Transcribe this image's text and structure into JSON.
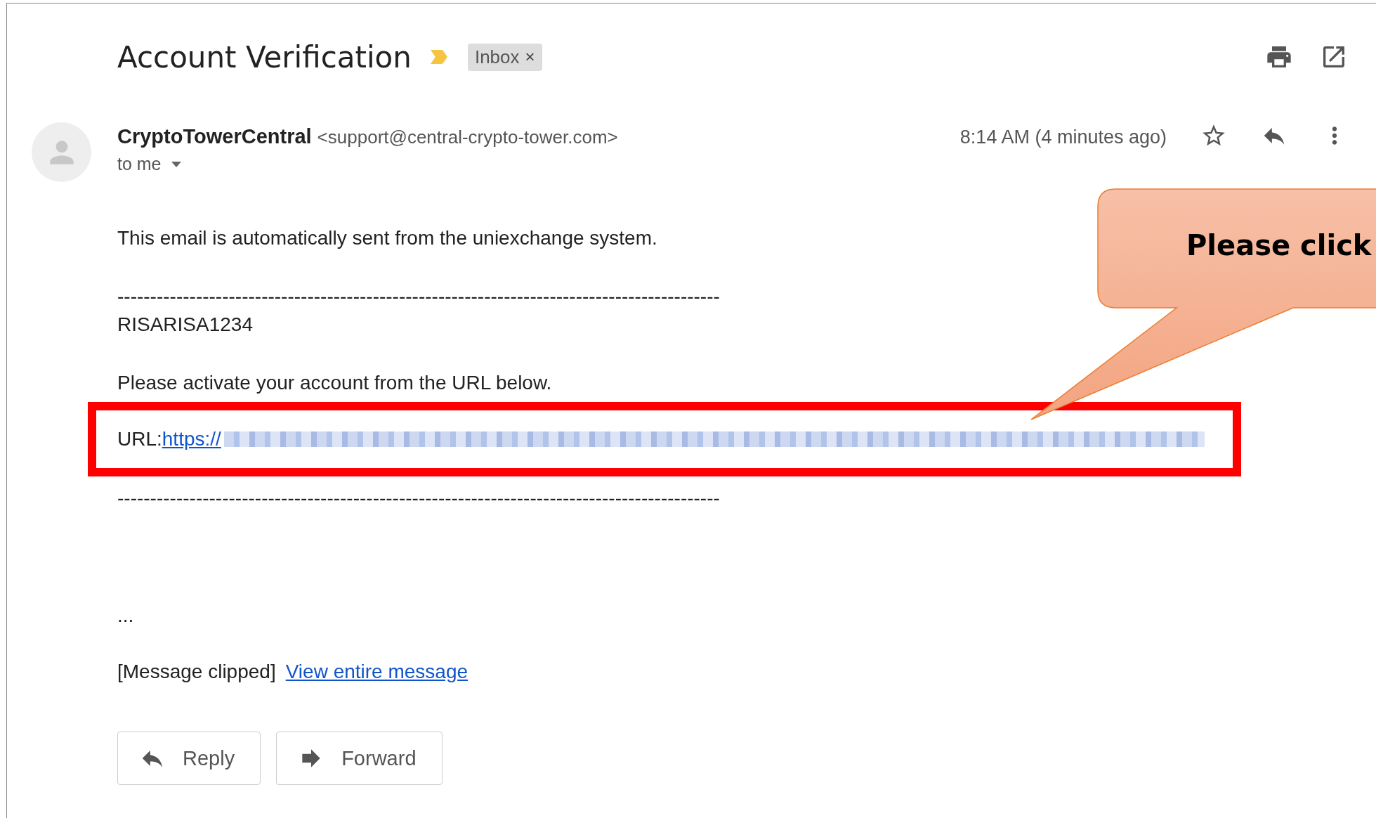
{
  "subject": "Account Verification",
  "important": true,
  "label": {
    "text": "Inbox",
    "remove": "×"
  },
  "sender": {
    "name": "CryptoTowerCentral",
    "email": "<support@central-crypto-tower.com>",
    "recipient": "to me",
    "time": "8:14 AM (4 minutes ago)",
    "starred": false
  },
  "paragraphs": [
    {
      "kind": "text",
      "lines": [
        "This email is automatically sent from the uniexchange system."
      ]
    },
    {
      "kind": "text",
      "lines": [
        "--------------------------------------------------------------------------------------------",
        "RISARISA1234"
      ]
    },
    {
      "kind": "text",
      "lines": [
        "Please activate your account from the URL below."
      ]
    },
    {
      "kind": "url",
      "label": "URL:",
      "link": "https://",
      "highlighted": true
    },
    {
      "kind": "text",
      "lines": [
        "--------------------------------------------------------------------------------------------"
      ]
    }
  ],
  "ellipsis": "...",
  "clipped": {
    "text": "[Message clipped]",
    "link": "View entire message"
  },
  "buttons": [
    {
      "kind": "reply",
      "label": "Reply"
    },
    {
      "kind": "forward",
      "label": "Forward"
    }
  ],
  "callout": {
    "text": "Please click"
  }
}
